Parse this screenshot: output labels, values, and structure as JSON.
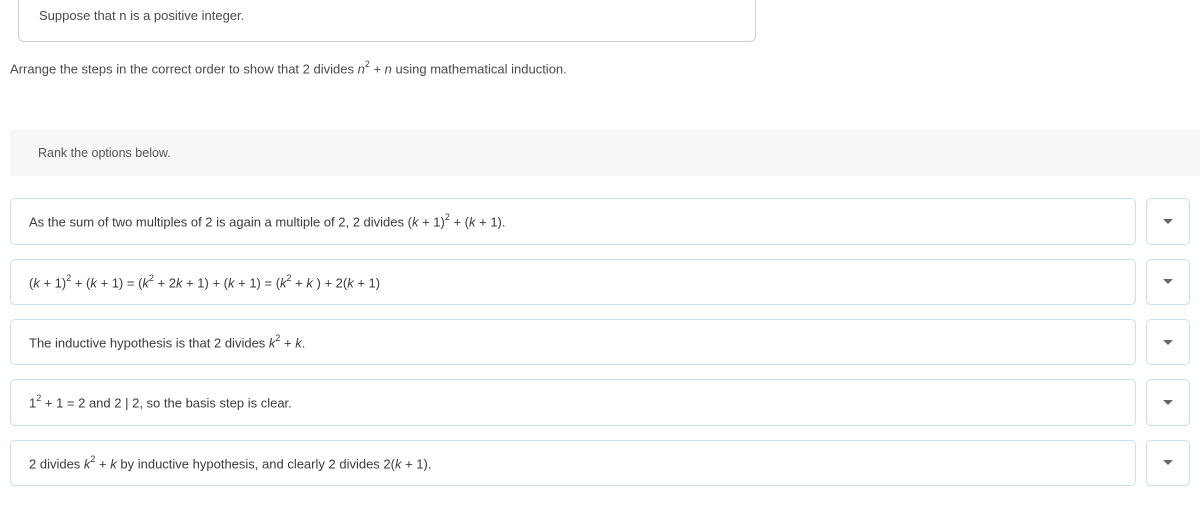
{
  "top_box": {
    "text_pre": "Suppose that ",
    "n": "n",
    "text_post": " is a positive integer."
  },
  "instruction": {
    "pre": "Arrange the steps in the correct order to show that  2 divides ",
    "n": "n",
    "sup": "2",
    "plus": " + ",
    "n2": "n",
    "post": " using mathematical induction."
  },
  "rank_label": "Rank the options below.",
  "options": [
    {
      "parts": [
        {
          "t": "As the sum of two multiples of 2 is again a multiple of 2, 2 divides ("
        },
        {
          "t": "k",
          "it": true
        },
        {
          "t": " + 1)"
        },
        {
          "t": "2",
          "sup": true
        },
        {
          "t": " + ("
        },
        {
          "t": "k",
          "it": true
        },
        {
          "t": " + 1)."
        }
      ]
    },
    {
      "parts": [
        {
          "t": "("
        },
        {
          "t": "k",
          "it": true
        },
        {
          "t": " + 1)"
        },
        {
          "t": "2",
          "sup": true
        },
        {
          "t": " + ("
        },
        {
          "t": "k",
          "it": true
        },
        {
          "t": " + 1) = ("
        },
        {
          "t": "k",
          "it": true
        },
        {
          "t": "2",
          "sup": true
        },
        {
          "t": " + 2"
        },
        {
          "t": "k",
          "it": true
        },
        {
          "t": " + 1) + ("
        },
        {
          "t": "k",
          "it": true
        },
        {
          "t": " + 1) = ("
        },
        {
          "t": "k",
          "it": true
        },
        {
          "t": "2",
          "sup": true
        },
        {
          "t": " + "
        },
        {
          "t": "k",
          "it": true
        },
        {
          "t": " ) + 2("
        },
        {
          "t": "k",
          "it": true
        },
        {
          "t": " + 1)"
        }
      ]
    },
    {
      "parts": [
        {
          "t": "The inductive hypothesis is that 2 divides "
        },
        {
          "t": "k",
          "it": true
        },
        {
          "t": "2",
          "sup": true
        },
        {
          "t": " + "
        },
        {
          "t": "k",
          "it": true
        },
        {
          "t": "."
        }
      ]
    },
    {
      "parts": [
        {
          "t": "1"
        },
        {
          "t": "2",
          "sup": true
        },
        {
          "t": " + 1 = 2 and 2 | 2, so the basis step is clear."
        }
      ]
    },
    {
      "parts": [
        {
          "t": "2 divides "
        },
        {
          "t": "k",
          "it": true
        },
        {
          "t": "2",
          "sup": true
        },
        {
          "t": " + "
        },
        {
          "t": "k",
          "it": true
        },
        {
          "t": " by inductive hypothesis, and clearly 2 divides 2("
        },
        {
          "t": "k",
          "it": true
        },
        {
          "t": " + 1)."
        }
      ]
    }
  ]
}
